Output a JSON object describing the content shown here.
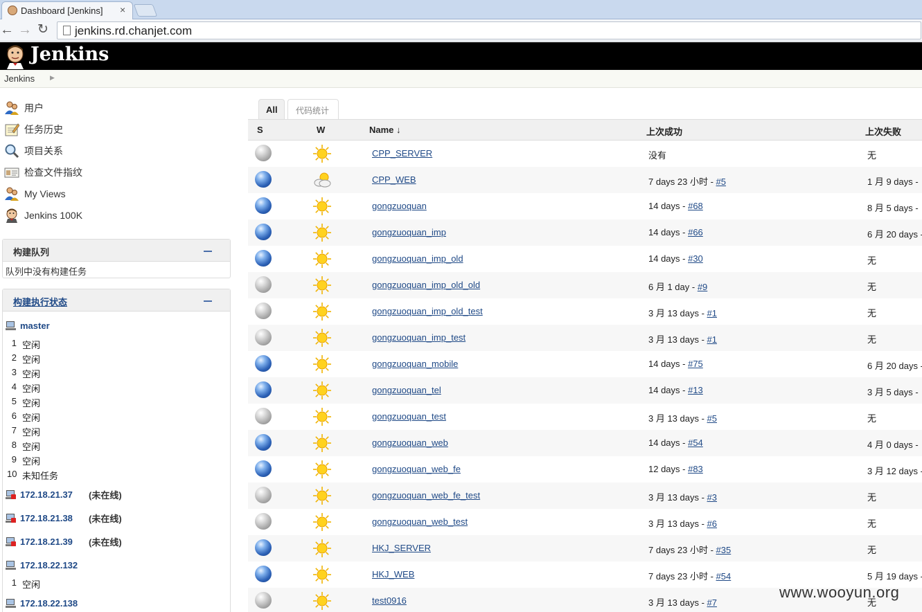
{
  "browser": {
    "tab_title": "Dashboard [Jenkins]",
    "tab_close": "×",
    "url": "jenkins.rd.chanjet.com"
  },
  "header": {
    "logo_text": "Jenkins",
    "breadcrumb": "Jenkins"
  },
  "sidebar": {
    "tasks": [
      {
        "label": "用户",
        "icon": "people-icon"
      },
      {
        "label": "任务历史",
        "icon": "notepad-icon"
      },
      {
        "label": "项目关系",
        "icon": "search-icon"
      },
      {
        "label": "检查文件指纹",
        "icon": "fingerprint-icon"
      },
      {
        "label": "My Views",
        "icon": "people-icon"
      },
      {
        "label": "Jenkins 100K",
        "icon": "jenkins-butler-icon"
      }
    ],
    "build_queue": {
      "title": "构建队列",
      "empty_text": "队列中没有构建任务"
    },
    "executors": {
      "title": "构建执行状态",
      "master": {
        "name": "master",
        "slots": [
          {
            "num": "1",
            "status": "空闲"
          },
          {
            "num": "2",
            "status": "空闲"
          },
          {
            "num": "3",
            "status": "空闲"
          },
          {
            "num": "4",
            "status": "空闲"
          },
          {
            "num": "5",
            "status": "空闲"
          },
          {
            "num": "6",
            "status": "空闲"
          },
          {
            "num": "7",
            "status": "空闲"
          },
          {
            "num": "8",
            "status": "空闲"
          },
          {
            "num": "9",
            "status": "空闲"
          },
          {
            "num": "10",
            "status": "未知任务"
          }
        ]
      },
      "offline_nodes": [
        {
          "name": "172.18.21.37",
          "status": "(未在线)"
        },
        {
          "name": "172.18.21.38",
          "status": "(未在线)"
        },
        {
          "name": "172.18.21.39",
          "status": "(未在线)"
        }
      ],
      "node_132": {
        "name": "172.18.22.132",
        "slots": [
          {
            "num": "1",
            "status": "空闲"
          }
        ]
      },
      "node_138": {
        "name": "172.18.22.138"
      }
    }
  },
  "views": {
    "tabs": [
      "All",
      "代码统计"
    ]
  },
  "table": {
    "headers": {
      "s": "S",
      "w": "W",
      "name": "Name ↓",
      "last_success": "上次成功",
      "last_failure": "上次失败"
    },
    "rows": [
      {
        "status": "grey",
        "weather": "sunny",
        "name": "CPP_SERVER",
        "success_text": "没有",
        "success_link": "",
        "failure": "无"
      },
      {
        "status": "blue",
        "weather": "cloudy",
        "name": "CPP_WEB",
        "success_text": "7 days 23 小时 - ",
        "success_link": "#5",
        "failure": "1 月 9 days -"
      },
      {
        "status": "blue",
        "weather": "sunny",
        "name": "gongzuoquan",
        "success_text": "14 days - ",
        "success_link": "#68",
        "failure": "8 月 5 days -"
      },
      {
        "status": "blue",
        "weather": "sunny",
        "name": "gongzuoquan_imp",
        "success_text": "14 days - ",
        "success_link": "#66",
        "failure": "6 月 20 days -"
      },
      {
        "status": "blue",
        "weather": "sunny",
        "name": "gongzuoquan_imp_old",
        "success_text": "14 days - ",
        "success_link": "#30",
        "failure": "无"
      },
      {
        "status": "grey",
        "weather": "sunny",
        "name": "gongzuoquan_imp_old_old",
        "success_text": "6 月 1 day - ",
        "success_link": "#9",
        "failure": "无"
      },
      {
        "status": "grey",
        "weather": "sunny",
        "name": "gongzuoquan_imp_old_test",
        "success_text": "3 月 13 days - ",
        "success_link": "#1",
        "failure": "无"
      },
      {
        "status": "grey",
        "weather": "sunny",
        "name": "gongzuoquan_imp_test",
        "success_text": "3 月 13 days - ",
        "success_link": "#1",
        "failure": "无"
      },
      {
        "status": "blue",
        "weather": "sunny",
        "name": "gongzuoquan_mobile",
        "success_text": "14 days - ",
        "success_link": "#75",
        "failure": "6 月 20 days -"
      },
      {
        "status": "blue",
        "weather": "sunny",
        "name": "gongzuoquan_tel",
        "success_text": "14 days - ",
        "success_link": "#13",
        "failure": "3 月 5 days -"
      },
      {
        "status": "grey",
        "weather": "sunny",
        "name": "gongzuoquan_test",
        "success_text": "3 月 13 days - ",
        "success_link": "#5",
        "failure": "无"
      },
      {
        "status": "blue",
        "weather": "sunny",
        "name": "gongzuoquan_web",
        "success_text": "14 days - ",
        "success_link": "#54",
        "failure": "4 月 0 days -"
      },
      {
        "status": "blue",
        "weather": "sunny",
        "name": "gongzuoquan_web_fe",
        "success_text": "12 days - ",
        "success_link": "#83",
        "failure": "3 月 12 days -"
      },
      {
        "status": "grey",
        "weather": "sunny",
        "name": "gongzuoquan_web_fe_test",
        "success_text": "3 月 13 days - ",
        "success_link": "#3",
        "failure": "无"
      },
      {
        "status": "grey",
        "weather": "sunny",
        "name": "gongzuoquan_web_test",
        "success_text": "3 月 13 days - ",
        "success_link": "#6",
        "failure": "无"
      },
      {
        "status": "blue",
        "weather": "sunny",
        "name": "HKJ_SERVER",
        "success_text": "7 days 23 小时 - ",
        "success_link": "#35",
        "failure": "无"
      },
      {
        "status": "blue",
        "weather": "sunny",
        "name": "HKJ_WEB",
        "success_text": "7 days 23 小时 - ",
        "success_link": "#54",
        "failure": "5 月 19 days -"
      },
      {
        "status": "grey",
        "weather": "sunny",
        "name": "test0916",
        "success_text": "3 月 13 days - ",
        "success_link": "#7",
        "failure": "无"
      }
    ]
  },
  "watermark": "www.wooyun.org",
  "colors": {
    "link": "#204a87",
    "header_bg": "#000000",
    "status_blue": "#2d62b7",
    "status_grey": "#a8a8a8"
  }
}
